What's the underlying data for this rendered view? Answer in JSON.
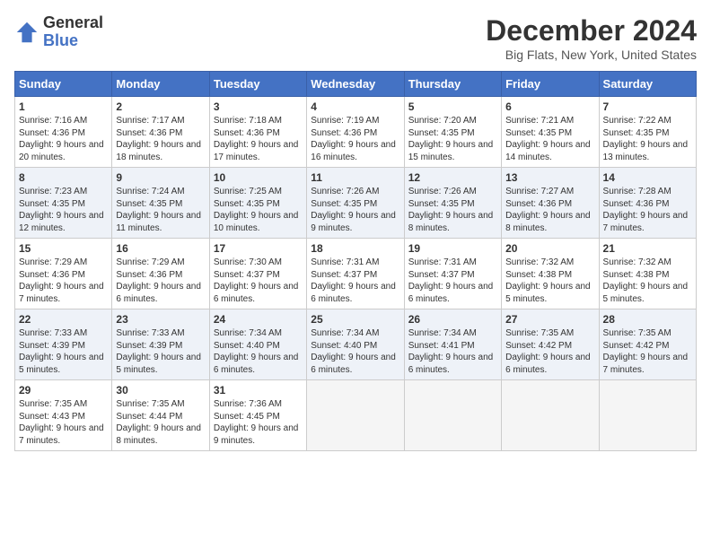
{
  "logo": {
    "general": "General",
    "blue": "Blue"
  },
  "title": "December 2024",
  "location": "Big Flats, New York, United States",
  "days_of_week": [
    "Sunday",
    "Monday",
    "Tuesday",
    "Wednesday",
    "Thursday",
    "Friday",
    "Saturday"
  ],
  "weeks": [
    [
      {
        "day": 1,
        "sunrise": "7:16 AM",
        "sunset": "4:36 PM",
        "daylight": "9 hours and 20 minutes."
      },
      {
        "day": 2,
        "sunrise": "7:17 AM",
        "sunset": "4:36 PM",
        "daylight": "9 hours and 18 minutes."
      },
      {
        "day": 3,
        "sunrise": "7:18 AM",
        "sunset": "4:36 PM",
        "daylight": "9 hours and 17 minutes."
      },
      {
        "day": 4,
        "sunrise": "7:19 AM",
        "sunset": "4:36 PM",
        "daylight": "9 hours and 16 minutes."
      },
      {
        "day": 5,
        "sunrise": "7:20 AM",
        "sunset": "4:35 PM",
        "daylight": "9 hours and 15 minutes."
      },
      {
        "day": 6,
        "sunrise": "7:21 AM",
        "sunset": "4:35 PM",
        "daylight": "9 hours and 14 minutes."
      },
      {
        "day": 7,
        "sunrise": "7:22 AM",
        "sunset": "4:35 PM",
        "daylight": "9 hours and 13 minutes."
      }
    ],
    [
      {
        "day": 8,
        "sunrise": "7:23 AM",
        "sunset": "4:35 PM",
        "daylight": "9 hours and 12 minutes."
      },
      {
        "day": 9,
        "sunrise": "7:24 AM",
        "sunset": "4:35 PM",
        "daylight": "9 hours and 11 minutes."
      },
      {
        "day": 10,
        "sunrise": "7:25 AM",
        "sunset": "4:35 PM",
        "daylight": "9 hours and 10 minutes."
      },
      {
        "day": 11,
        "sunrise": "7:26 AM",
        "sunset": "4:35 PM",
        "daylight": "9 hours and 9 minutes."
      },
      {
        "day": 12,
        "sunrise": "7:26 AM",
        "sunset": "4:35 PM",
        "daylight": "9 hours and 8 minutes."
      },
      {
        "day": 13,
        "sunrise": "7:27 AM",
        "sunset": "4:36 PM",
        "daylight": "9 hours and 8 minutes."
      },
      {
        "day": 14,
        "sunrise": "7:28 AM",
        "sunset": "4:36 PM",
        "daylight": "9 hours and 7 minutes."
      }
    ],
    [
      {
        "day": 15,
        "sunrise": "7:29 AM",
        "sunset": "4:36 PM",
        "daylight": "9 hours and 7 minutes."
      },
      {
        "day": 16,
        "sunrise": "7:29 AM",
        "sunset": "4:36 PM",
        "daylight": "9 hours and 6 minutes."
      },
      {
        "day": 17,
        "sunrise": "7:30 AM",
        "sunset": "4:37 PM",
        "daylight": "9 hours and 6 minutes."
      },
      {
        "day": 18,
        "sunrise": "7:31 AM",
        "sunset": "4:37 PM",
        "daylight": "9 hours and 6 minutes."
      },
      {
        "day": 19,
        "sunrise": "7:31 AM",
        "sunset": "4:37 PM",
        "daylight": "9 hours and 6 minutes."
      },
      {
        "day": 20,
        "sunrise": "7:32 AM",
        "sunset": "4:38 PM",
        "daylight": "9 hours and 5 minutes."
      },
      {
        "day": 21,
        "sunrise": "7:32 AM",
        "sunset": "4:38 PM",
        "daylight": "9 hours and 5 minutes."
      }
    ],
    [
      {
        "day": 22,
        "sunrise": "7:33 AM",
        "sunset": "4:39 PM",
        "daylight": "9 hours and 5 minutes."
      },
      {
        "day": 23,
        "sunrise": "7:33 AM",
        "sunset": "4:39 PM",
        "daylight": "9 hours and 5 minutes."
      },
      {
        "day": 24,
        "sunrise": "7:34 AM",
        "sunset": "4:40 PM",
        "daylight": "9 hours and 6 minutes."
      },
      {
        "day": 25,
        "sunrise": "7:34 AM",
        "sunset": "4:40 PM",
        "daylight": "9 hours and 6 minutes."
      },
      {
        "day": 26,
        "sunrise": "7:34 AM",
        "sunset": "4:41 PM",
        "daylight": "9 hours and 6 minutes."
      },
      {
        "day": 27,
        "sunrise": "7:35 AM",
        "sunset": "4:42 PM",
        "daylight": "9 hours and 6 minutes."
      },
      {
        "day": 28,
        "sunrise": "7:35 AM",
        "sunset": "4:42 PM",
        "daylight": "9 hours and 7 minutes."
      }
    ],
    [
      {
        "day": 29,
        "sunrise": "7:35 AM",
        "sunset": "4:43 PM",
        "daylight": "9 hours and 7 minutes."
      },
      {
        "day": 30,
        "sunrise": "7:35 AM",
        "sunset": "4:44 PM",
        "daylight": "9 hours and 8 minutes."
      },
      {
        "day": 31,
        "sunrise": "7:36 AM",
        "sunset": "4:45 PM",
        "daylight": "9 hours and 9 minutes."
      },
      null,
      null,
      null,
      null
    ]
  ]
}
